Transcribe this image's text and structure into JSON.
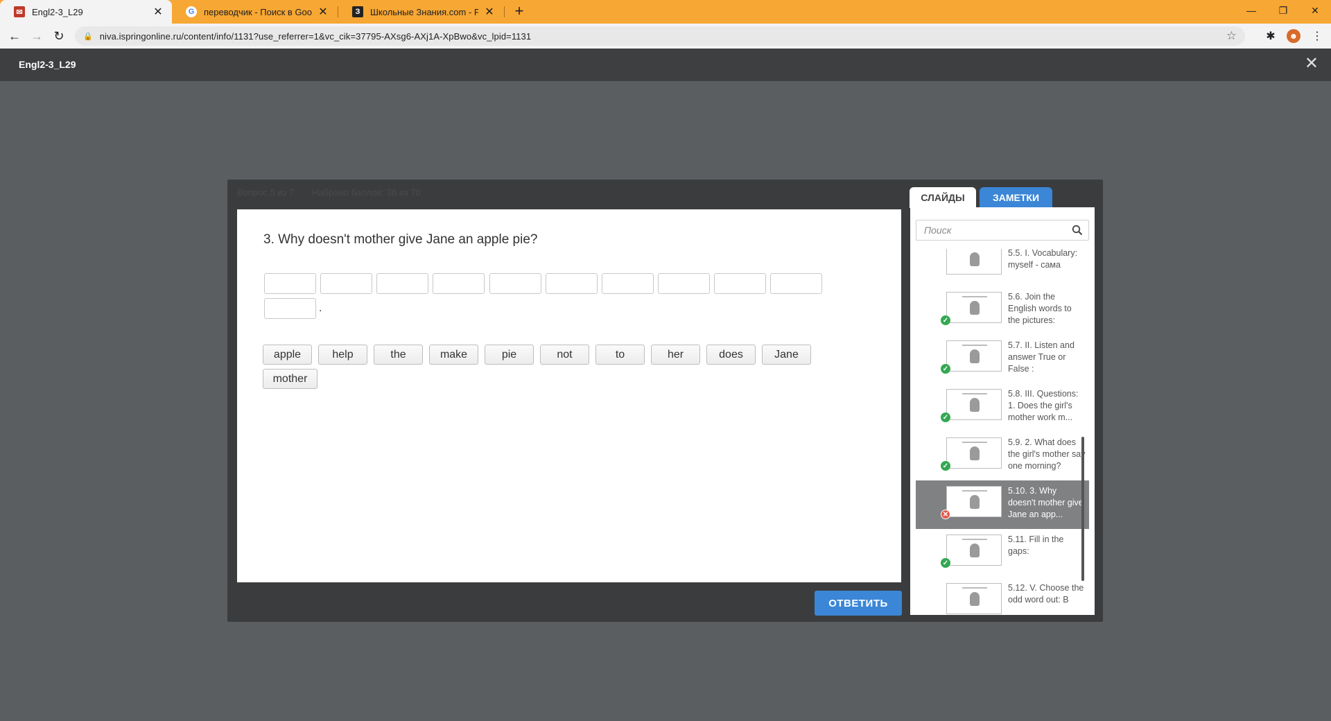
{
  "browser": {
    "tabs": [
      {
        "title": "Engl2-3_L29",
        "icon": "ispring-favicon"
      },
      {
        "title": "переводчик - Поиск в Google",
        "icon": "google-favicon"
      },
      {
        "title": "Школьные Знания.com - Решае",
        "icon": "znania-favicon"
      }
    ],
    "url": "niva.ispringonline.ru/content/info/1131?use_referrer=1&vc_cik=37795-AXsg6-AXj1A-XpBwo&vc_lpid=1131"
  },
  "player": {
    "title": "Engl2-3_L29",
    "question_counter": "Вопрос 5 из 7",
    "score": "Набрано баллов: 36 из 70",
    "submit_label": "ОТВЕТИТЬ"
  },
  "question": {
    "text": "3. Why doesn't mother give Jane an apple pie?",
    "blank_count": 11,
    "end_punct": ".",
    "words": [
      "apple",
      "help",
      "the",
      "make",
      "pie",
      "not",
      "to",
      "her",
      "does",
      "Jane",
      "mother"
    ]
  },
  "sidebar": {
    "tab_slides": "СЛАЙДЫ",
    "tab_notes": "ЗАМЕТКИ",
    "search_placeholder": "Поиск",
    "items": [
      {
        "text": "5.5. I. Vocabulary: myself - сама",
        "status": "none"
      },
      {
        "text": "5.6. Join the English words to the pictures:",
        "status": "ok"
      },
      {
        "text": "5.7. II. Listen and answer True or False :",
        "status": "ok"
      },
      {
        "text": "5.8. III. Questions: 1. Does the girl's mother work m...",
        "status": "ok"
      },
      {
        "text": "5.9. 2. What does the girl's mother say one morning?",
        "status": "ok"
      },
      {
        "text": "5.10. 3. Why doesn't mother give Jane an app...",
        "status": "err",
        "active": true
      },
      {
        "text": "5.11. Fill in the gaps:",
        "status": "ok"
      },
      {
        "text": "5.12. V. Choose the odd word out: B",
        "status": "none"
      }
    ]
  }
}
